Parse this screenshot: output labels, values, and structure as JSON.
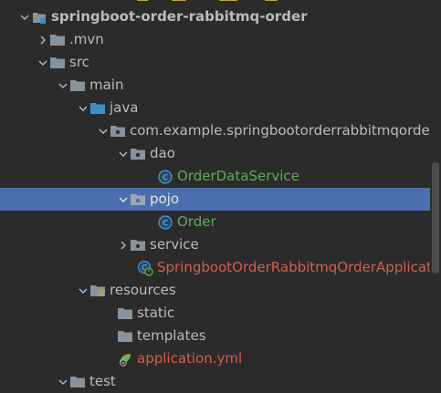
{
  "tree": {
    "project": "springboot-order-rabbitmq-order",
    "mvn": ".mvn",
    "src": "src",
    "main": "main",
    "java": "java",
    "package": "com.example.springbootorderrabbitmqorde",
    "dao": "dao",
    "order_data_service": "OrderDataService",
    "pojo": "pojo",
    "order": "Order",
    "service": "service",
    "app_class": "SpringbootOrderRabbitmqOrderApplicati",
    "resources": "resources",
    "static": "static",
    "templates": "templates",
    "application_yml": "application.yml",
    "test": "test"
  },
  "colors": {
    "background": "#2b2b2b",
    "selection": "#4b6eaf",
    "default_text": "#bbbbbb",
    "modified_green": "#62a85a",
    "unversioned_red": "#d35e4f",
    "folder": "#87939a",
    "class_icon": "#3d9be9"
  },
  "icons": {
    "expanded": "chevron-down-icon",
    "collapsed": "chevron-right-icon",
    "module": "module-icon",
    "folder": "folder-icon",
    "source_root": "source-root-folder-icon",
    "package": "package-icon",
    "class": "class-icon",
    "spring_boot_app": "spring-boot-app-icon",
    "resources_root": "resources-root-folder-icon",
    "yaml_config": "spring-yaml-icon"
  }
}
